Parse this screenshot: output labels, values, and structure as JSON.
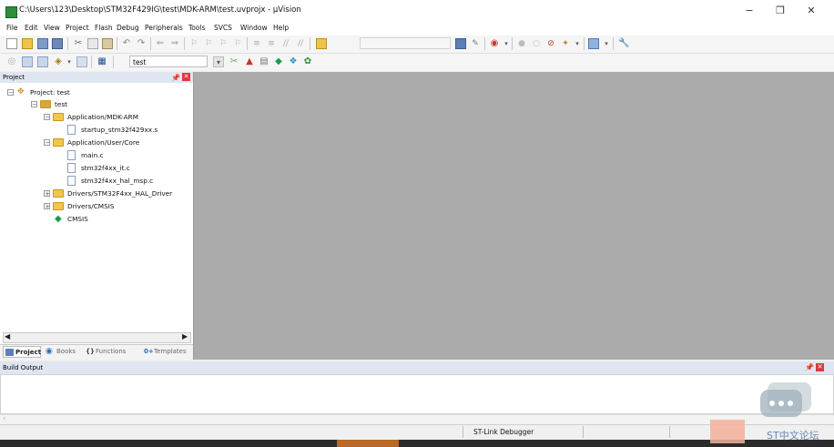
{
  "window": {
    "title": "C:\\Users\\123\\Desktop\\STM32F429IG\\test\\MDK-ARM\\test.uvprojx - µVision",
    "minimize_glyph": "−",
    "maximize_glyph": "❐",
    "close_glyph": "✕"
  },
  "menu": {
    "items": [
      "File",
      "Edit",
      "View",
      "Project",
      "Flash",
      "Debug",
      "Peripherals",
      "Tools",
      "SVCS",
      "Window",
      "Help"
    ]
  },
  "toolbar2": {
    "target": "test"
  },
  "project_pane": {
    "title": "Project",
    "tree": [
      {
        "label": "Project: test",
        "icon": "project-icon"
      },
      {
        "label": "test",
        "icon": "target-folder-icon"
      },
      {
        "label": "Application/MDK-ARM",
        "icon": "folder-icon"
      },
      {
        "label": "startup_stm32f429xx.s",
        "icon": "file-icon"
      },
      {
        "label": "Application/User/Core",
        "icon": "folder-icon"
      },
      {
        "label": "main.c",
        "icon": "file-icon"
      },
      {
        "label": "stm32f4xx_it.c",
        "icon": "file-icon"
      },
      {
        "label": "stm32f4xx_hal_msp.c",
        "icon": "file-icon"
      },
      {
        "label": "Drivers/STM32F4xx_HAL_Driver",
        "icon": "folder-icon"
      },
      {
        "label": "Drivers/CMSIS",
        "icon": "folder-icon"
      },
      {
        "label": "CMSIS",
        "icon": "cmsis-diamond-icon"
      }
    ],
    "tabs": [
      "Project",
      "Books",
      "Functions",
      "Templates"
    ]
  },
  "build_output": {
    "title": "Build Output"
  },
  "status": {
    "debugger": "ST-Link Debugger"
  },
  "watermark": {
    "text": "ST中文论坛"
  },
  "colors": {
    "editor_background": "#ababab",
    "pane_header": "#dfe6f1",
    "close_red": "#d83b3b",
    "folder_yellow": "#f3c64c"
  }
}
